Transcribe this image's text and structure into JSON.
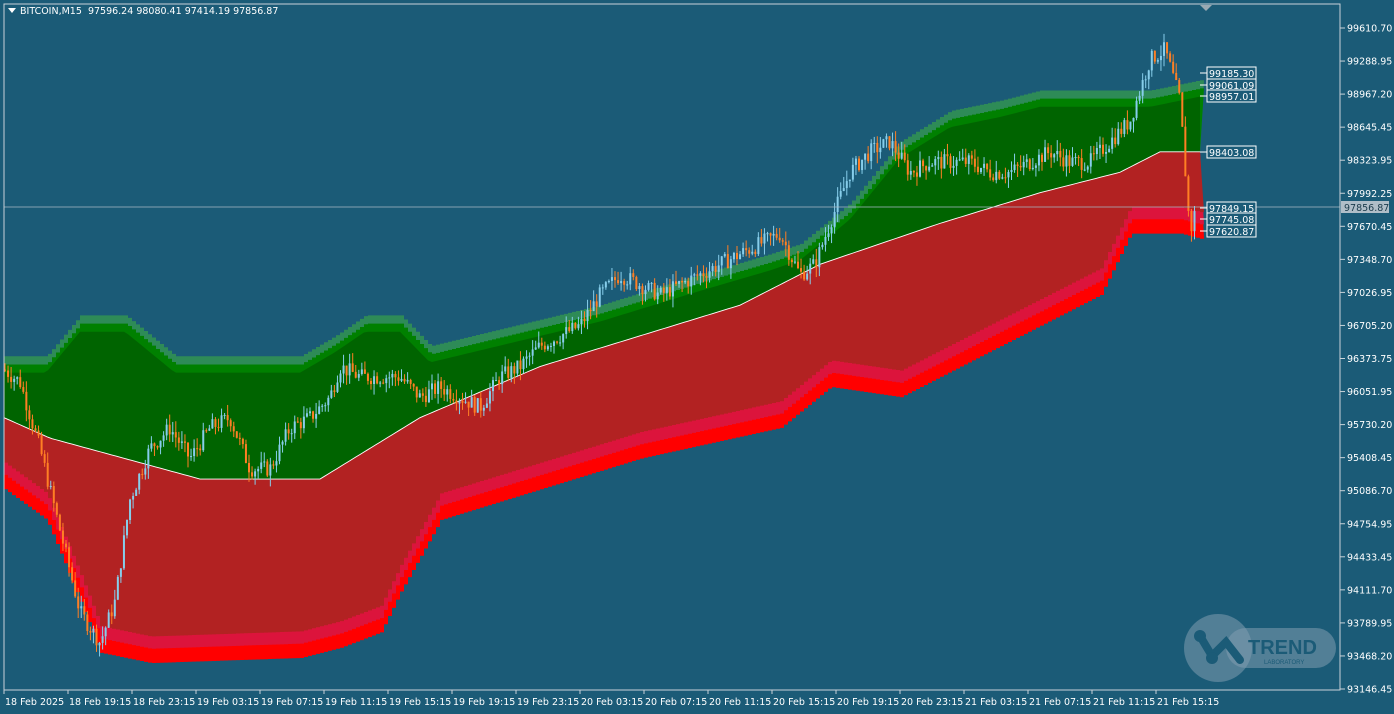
{
  "header": {
    "symbol": "BITCOIN,M15",
    "open": "97596.24",
    "high": "98080.41",
    "low": "97414.19",
    "close": "97856.87"
  },
  "logo": {
    "name": "TREND",
    "sub": "LABORATORY"
  },
  "colors": {
    "background": "#1b5b77",
    "band_green_dark": "#006400",
    "band_green_mid": "#008000",
    "band_green_light": "#2e8b57",
    "band_red_dark": "#b22222",
    "band_red_mid": "#dc143c",
    "band_red_light": "#ff0000",
    "candle_up": "#87ceeb",
    "candle_down": "#ff7f24",
    "axis_text": "#ffffff"
  },
  "price_labels": [
    {
      "value": "99185.30",
      "level": 99185.3
    },
    {
      "value": "99061.09",
      "level": 99061.09
    },
    {
      "value": "98957.01",
      "level": 98957.01
    },
    {
      "value": "98403.08",
      "level": 98403.08
    },
    {
      "value": "97849.15",
      "level": 97849.15
    },
    {
      "value": "97745.08",
      "level": 97745.08
    },
    {
      "value": "97620.87",
      "level": 97620.87
    }
  ],
  "chart_data": {
    "type": "candlestick",
    "y_ticks": [
      "99610.70",
      "99288.95",
      "98967.20",
      "98645.45",
      "98323.95",
      "97992.25",
      "97670.45",
      "97348.70",
      "97026.95",
      "96705.20",
      "96373.75",
      "96051.95",
      "95730.20",
      "95408.45",
      "95086.70",
      "94754.95",
      "94433.45",
      "94111.70",
      "93789.95",
      "93468.20",
      "93146.45"
    ],
    "ylim": [
      93146.45,
      99610.7
    ],
    "x_ticks": [
      "18 Feb 2025",
      "18 Feb 19:15",
      "18 Feb 23:15",
      "19 Feb 03:15",
      "19 Feb 07:15",
      "19 Feb 11:15",
      "19 Feb 15:15",
      "19 Feb 19:15",
      "19 Feb 23:15",
      "20 Feb 03:15",
      "20 Feb 07:15",
      "20 Feb 11:15",
      "20 Feb 15:15",
      "20 Feb 19:15",
      "20 Feb 23:15",
      "21 Feb 03:15",
      "21 Feb 07:15",
      "21 Feb 11:15",
      "21 Feb 15:15"
    ],
    "current_price": {
      "label": "97856.87",
      "value": 97856.87
    },
    "price_path": [
      [
        0,
        96300
      ],
      [
        20,
        96150
      ],
      [
        40,
        95500
      ],
      [
        60,
        94700
      ],
      [
        80,
        93900
      ],
      [
        100,
        93600
      ],
      [
        115,
        94000
      ],
      [
        130,
        95000
      ],
      [
        150,
        95500
      ],
      [
        170,
        95700
      ],
      [
        190,
        95400
      ],
      [
        210,
        95700
      ],
      [
        230,
        95800
      ],
      [
        250,
        95300
      ],
      [
        270,
        95300
      ],
      [
        290,
        95700
      ],
      [
        310,
        95800
      ],
      [
        330,
        96000
      ],
      [
        340,
        96300
      ],
      [
        360,
        96200
      ],
      [
        380,
        96200
      ],
      [
        400,
        96200
      ],
      [
        420,
        96000
      ],
      [
        440,
        96100
      ],
      [
        460,
        96000
      ],
      [
        480,
        95900
      ],
      [
        500,
        96200
      ],
      [
        520,
        96300
      ],
      [
        540,
        96500
      ],
      [
        560,
        96600
      ],
      [
        580,
        96700
      ],
      [
        600,
        97000
      ],
      [
        620,
        97200
      ],
      [
        640,
        97100
      ],
      [
        660,
        97000
      ],
      [
        680,
        97100
      ],
      [
        700,
        97200
      ],
      [
        720,
        97300
      ],
      [
        740,
        97400
      ],
      [
        760,
        97500
      ],
      [
        780,
        97600
      ],
      [
        800,
        97200
      ],
      [
        815,
        97300
      ],
      [
        830,
        97700
      ],
      [
        850,
        98200
      ],
      [
        870,
        98400
      ],
      [
        890,
        98500
      ],
      [
        910,
        98200
      ],
      [
        930,
        98300
      ],
      [
        950,
        98300
      ],
      [
        970,
        98300
      ],
      [
        990,
        98200
      ],
      [
        1010,
        98200
      ],
      [
        1030,
        98300
      ],
      [
        1050,
        98400
      ],
      [
        1070,
        98300
      ],
      [
        1090,
        98300
      ],
      [
        1110,
        98500
      ],
      [
        1130,
        98700
      ],
      [
        1150,
        99300
      ],
      [
        1165,
        99400
      ],
      [
        1180,
        98900
      ],
      [
        1190,
        97600
      ],
      [
        1196,
        97850
      ]
    ],
    "band_upper": [
      [
        4,
        96400
      ],
      [
        46,
        96400
      ],
      [
        80,
        96800
      ],
      [
        125,
        96800
      ],
      [
        175,
        96400
      ],
      [
        300,
        96400
      ],
      [
        335,
        96600
      ],
      [
        365,
        96800
      ],
      [
        400,
        96800
      ],
      [
        430,
        96500
      ],
      [
        600,
        96900
      ],
      [
        700,
        97200
      ],
      [
        770,
        97400
      ],
      [
        800,
        97500
      ],
      [
        850,
        97900
      ],
      [
        900,
        98500
      ],
      [
        950,
        98800
      ],
      [
        1000,
        98900
      ],
      [
        1040,
        99000
      ],
      [
        1100,
        99000
      ],
      [
        1150,
        99000
      ],
      [
        1200,
        99100
      ]
    ],
    "band_middle": [
      [
        4,
        95800
      ],
      [
        50,
        95600
      ],
      [
        125,
        95400
      ],
      [
        200,
        95200
      ],
      [
        320,
        95200
      ],
      [
        420,
        95800
      ],
      [
        540,
        96300
      ],
      [
        640,
        96600
      ],
      [
        740,
        96900
      ],
      [
        820,
        97300
      ],
      [
        940,
        97700
      ],
      [
        1040,
        98000
      ],
      [
        1120,
        98200
      ],
      [
        1160,
        98400
      ],
      [
        1200,
        98400
      ]
    ],
    "band_lower": [
      [
        4,
        95100
      ],
      [
        46,
        94800
      ],
      [
        80,
        94000
      ],
      [
        100,
        93500
      ],
      [
        150,
        93400
      ],
      [
        300,
        93450
      ],
      [
        340,
        93550
      ],
      [
        380,
        93700
      ],
      [
        400,
        94100
      ],
      [
        440,
        94800
      ],
      [
        540,
        95100
      ],
      [
        640,
        95400
      ],
      [
        780,
        95700
      ],
      [
        830,
        96100
      ],
      [
        900,
        96000
      ],
      [
        1000,
        96500
      ],
      [
        1100,
        97000
      ],
      [
        1130,
        97600
      ],
      [
        1180,
        97600
      ],
      [
        1200,
        97550
      ]
    ]
  }
}
